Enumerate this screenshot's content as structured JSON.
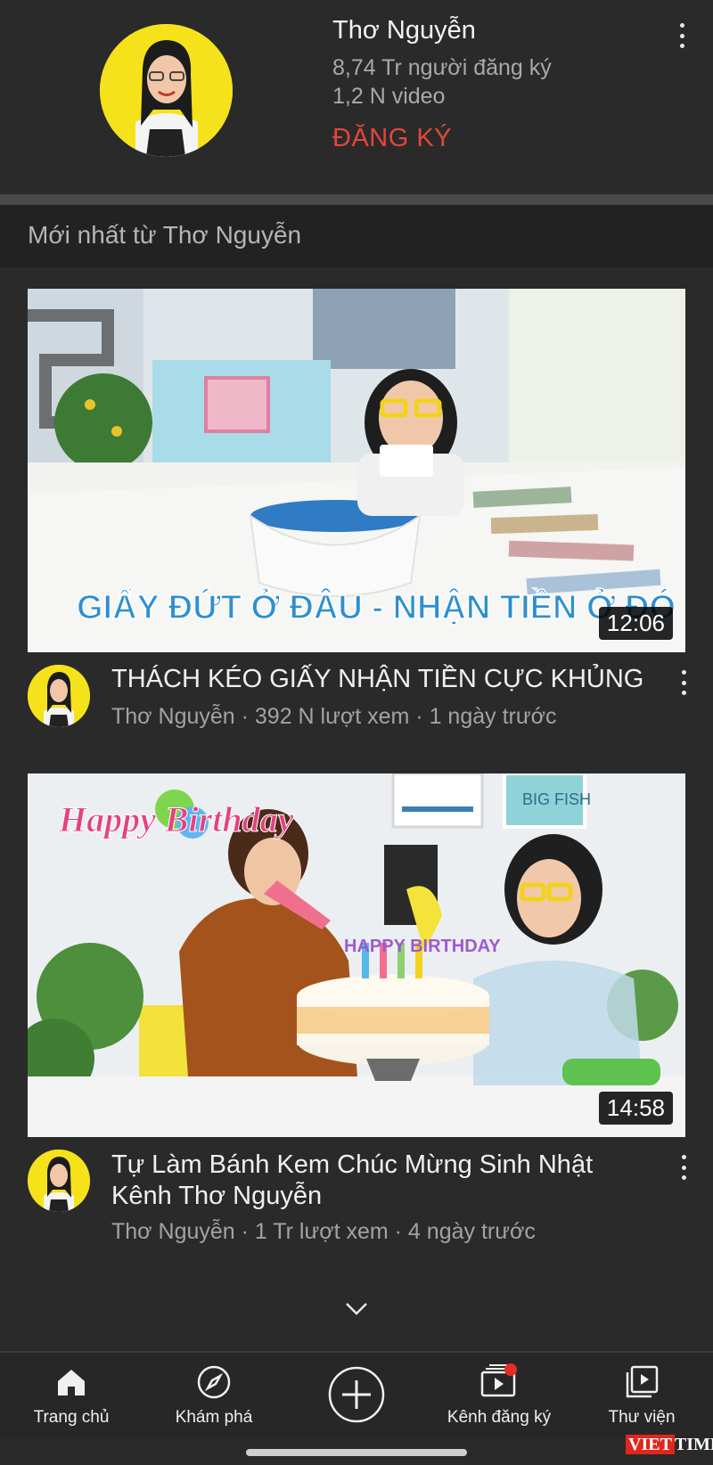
{
  "channel": {
    "name": "Thơ Nguyễn",
    "subscribers": "8,74 Tr người đăng ký",
    "video_count": "1,2 N video",
    "subscribe_label": "ĐĂNG KÝ"
  },
  "section": {
    "title": "Mới nhất từ Thơ Nguyễn"
  },
  "videos": [
    {
      "thumbnail_caption": "GIẤY ĐỨT Ở ĐÂU - NHẬN TIỀN Ở ĐÓ",
      "duration": "12:06",
      "title": "THÁCH KÉO GIẤY NHẬN TIỀN CỰC KHỦNG",
      "meta": "Thơ Nguyễn · 392 N lượt xem · 1 ngày trước"
    },
    {
      "thumbnail_caption": "Happy Birthday",
      "cake_topper": "HAPPY BIRTHDAY",
      "sign_text": "BIG FISH",
      "duration": "14:58",
      "title": "Tự Làm Bánh Kem Chúc Mừng Sinh Nhật Kênh Thơ Nguyễn",
      "meta": "Thơ Nguyễn · 1 Tr lượt xem · 4 ngày trước"
    }
  ],
  "bottom_nav": {
    "home": "Trang chủ",
    "explore": "Khám phá",
    "subscriptions": "Kênh đăng ký",
    "library": "Thư viện"
  },
  "watermark": {
    "brand_a": "VIET",
    "brand_b": "TIMES"
  },
  "colors": {
    "accent_red": "#e2473c",
    "background": "#2a2a2a",
    "avatar_yellow": "#f6e21a"
  },
  "icons": [
    "more-vert-icon",
    "chevron-down-icon",
    "home-icon",
    "compass-icon",
    "add-circle-icon",
    "subscriptions-icon",
    "library-icon"
  ]
}
